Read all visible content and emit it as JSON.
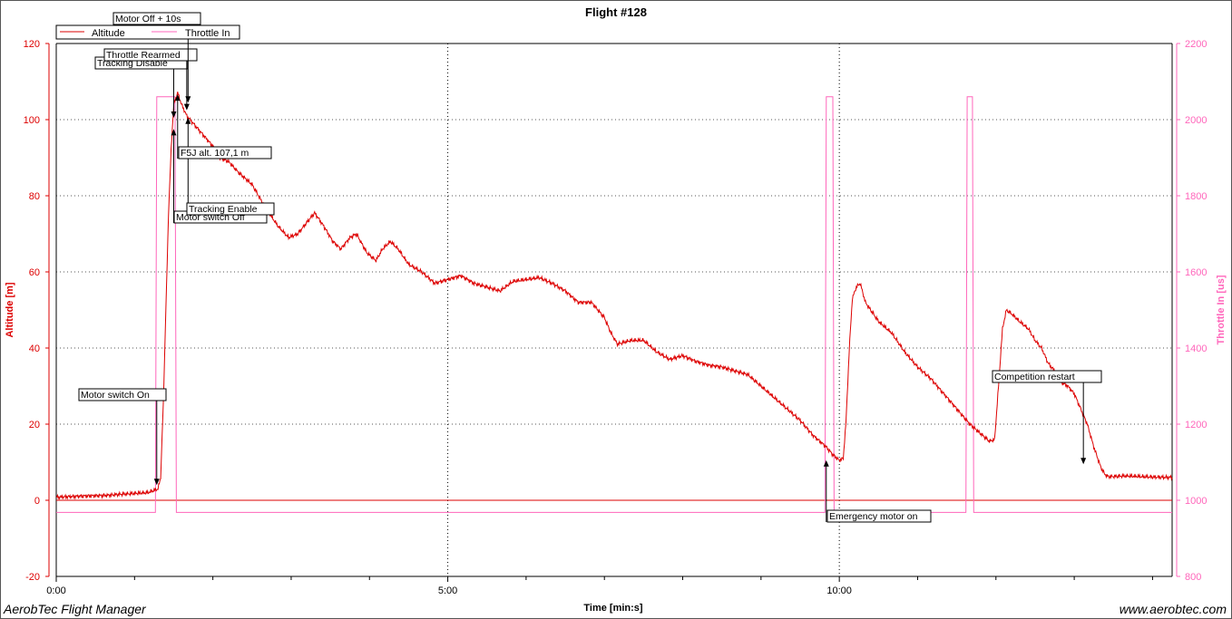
{
  "chart_data": {
    "type": "line",
    "title": "Flight #128",
    "xlabel": "Time [min:s]",
    "ylabel": "Altitude [m]",
    "y2label": "Throttle In [us]",
    "x_range_seconds": [
      0,
      855
    ],
    "xticks": [
      {
        "t": 0,
        "label": "0:00"
      },
      {
        "t": 300,
        "label": "5:00"
      },
      {
        "t": 600,
        "label": "10:00"
      }
    ],
    "ylim": [
      -20,
      120
    ],
    "yticks": [
      "-20",
      "0",
      "20",
      "40",
      "60",
      "80",
      "100",
      "120"
    ],
    "y2lim": [
      800,
      2200
    ],
    "y2ticks": [
      "800",
      "1000",
      "1200",
      "1400",
      "1600",
      "1800",
      "2000",
      "2200"
    ],
    "grid": "dotted",
    "legend_position": "top-left",
    "colors": {
      "altitude": "#dd0000",
      "throttle": "#ff66bb",
      "altitude_axis": "#dd0000",
      "throttle_axis": "#ff66bb"
    },
    "series": [
      {
        "name": "Altitude",
        "axis": "left",
        "points": [
          [
            0,
            0.8
          ],
          [
            20,
            1.1
          ],
          [
            40,
            1.3
          ],
          [
            50,
            1.6
          ],
          [
            60,
            1.8
          ],
          [
            70,
            2.0
          ],
          [
            78,
            3.0
          ],
          [
            80,
            6
          ],
          [
            82,
            25
          ],
          [
            84,
            50
          ],
          [
            86,
            75
          ],
          [
            88,
            92
          ],
          [
            90,
            104
          ],
          [
            93,
            107.1
          ],
          [
            96,
            104
          ],
          [
            100,
            101
          ],
          [
            105,
            99
          ],
          [
            110,
            97
          ],
          [
            115,
            95
          ],
          [
            120,
            93
          ],
          [
            125,
            90
          ],
          [
            132,
            89
          ],
          [
            140,
            86
          ],
          [
            150,
            83
          ],
          [
            160,
            77
          ],
          [
            170,
            72
          ],
          [
            178,
            69
          ],
          [
            185,
            70
          ],
          [
            192,
            73
          ],
          [
            198,
            75.5
          ],
          [
            205,
            72
          ],
          [
            212,
            68
          ],
          [
            218,
            66
          ],
          [
            225,
            69
          ],
          [
            230,
            70
          ],
          [
            238,
            65
          ],
          [
            245,
            63
          ],
          [
            250,
            66
          ],
          [
            256,
            68
          ],
          [
            262,
            66
          ],
          [
            270,
            62
          ],
          [
            280,
            60
          ],
          [
            290,
            57
          ],
          [
            300,
            58
          ],
          [
            310,
            59
          ],
          [
            320,
            57
          ],
          [
            330,
            56
          ],
          [
            340,
            55
          ],
          [
            350,
            57.5
          ],
          [
            360,
            58
          ],
          [
            370,
            58.5
          ],
          [
            380,
            57
          ],
          [
            390,
            55
          ],
          [
            400,
            52
          ],
          [
            410,
            52
          ],
          [
            420,
            48
          ],
          [
            425,
            44
          ],
          [
            430,
            41
          ],
          [
            440,
            42
          ],
          [
            450,
            42
          ],
          [
            460,
            39
          ],
          [
            470,
            37
          ],
          [
            480,
            38
          ],
          [
            490,
            36.5
          ],
          [
            500,
            35.5
          ],
          [
            510,
            35
          ],
          [
            520,
            34
          ],
          [
            530,
            33
          ],
          [
            540,
            30
          ],
          [
            550,
            27
          ],
          [
            560,
            24
          ],
          [
            570,
            21
          ],
          [
            580,
            17
          ],
          [
            590,
            14
          ],
          [
            595,
            12
          ],
          [
            600,
            10.5
          ],
          [
            603,
            11
          ],
          [
            605,
            20
          ],
          [
            608,
            42
          ],
          [
            610,
            53
          ],
          [
            613,
            56
          ],
          [
            616,
            57
          ],
          [
            620,
            52
          ],
          [
            630,
            47
          ],
          [
            640,
            44
          ],
          [
            650,
            39
          ],
          [
            660,
            35
          ],
          [
            670,
            32
          ],
          [
            680,
            28
          ],
          [
            690,
            24
          ],
          [
            700,
            20
          ],
          [
            710,
            17
          ],
          [
            715,
            15.5
          ],
          [
            719,
            16
          ],
          [
            722,
            30
          ],
          [
            725,
            45
          ],
          [
            728,
            50
          ],
          [
            732,
            49
          ],
          [
            738,
            47
          ],
          [
            745,
            45
          ],
          [
            750,
            42
          ],
          [
            755,
            40
          ],
          [
            760,
            36
          ],
          [
            765,
            34
          ],
          [
            770,
            31
          ],
          [
            775,
            30
          ],
          [
            780,
            28
          ],
          [
            785,
            24
          ],
          [
            790,
            20
          ],
          [
            795,
            14
          ],
          [
            800,
            9
          ],
          [
            803,
            7
          ],
          [
            806,
            6.2
          ],
          [
            820,
            6.4
          ],
          [
            840,
            6.1
          ],
          [
            855,
            6.0
          ]
        ]
      },
      {
        "name": "Throttle In",
        "axis": "right",
        "points": [
          [
            0,
            968
          ],
          [
            76,
            968
          ],
          [
            77,
            2060
          ],
          [
            91,
            2060
          ],
          [
            92,
            968
          ],
          [
            589,
            968
          ],
          [
            590,
            2060
          ],
          [
            595,
            2060
          ],
          [
            596,
            968
          ],
          [
            697,
            968
          ],
          [
            698,
            2060
          ],
          [
            702,
            2060
          ],
          [
            703,
            968
          ],
          [
            855,
            968
          ]
        ]
      }
    ],
    "annotations": [
      {
        "text": "Motor switch On",
        "t": 77,
        "alt": 3.5
      },
      {
        "text": "Tracking Disable",
        "t": 90,
        "alt": 100
      },
      {
        "text": "Motor switch Off",
        "t": 90,
        "alt": 98
      },
      {
        "text": "Throttle Rearmed",
        "t": 100,
        "alt": 102
      },
      {
        "text": "Motor Off + 10s",
        "t": 101,
        "alt": 104
      },
      {
        "text": "Tracking Enable",
        "t": 101,
        "alt": 101
      },
      {
        "text": "F5J alt. 107,1 m",
        "t": 93,
        "alt": 107.1
      },
      {
        "text": "Emergency motor on",
        "t": 590,
        "alt": 11
      },
      {
        "text": "Competition restart",
        "t": 787,
        "alt": 9
      }
    ]
  },
  "footer": {
    "left": "AerobTec Flight Manager",
    "right": "www.aerobtec.com"
  }
}
